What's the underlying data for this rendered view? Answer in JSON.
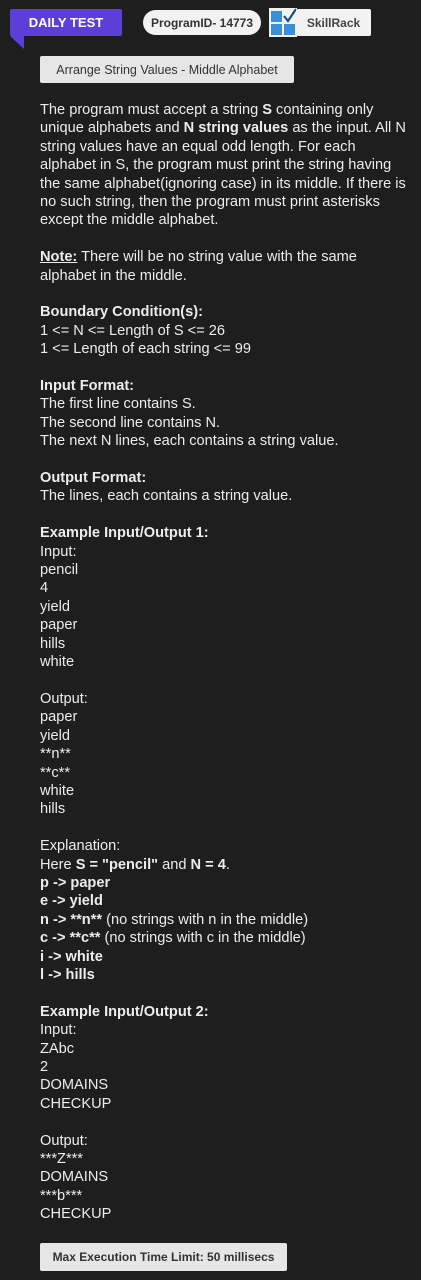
{
  "header": {
    "daily_test": "DAILY TEST",
    "program_id": "ProgramID- 14773",
    "skillrack": "SkillRack",
    "logo_icon": "skillrack-logo-icon"
  },
  "problem_title": "Arrange String Values - Middle Alphabet",
  "description": {
    "p1": "The program must accept a string ",
    "s_var": "S",
    "p2": " containing only unique alphabets and ",
    "n_var": "N string values",
    "p3": " as the input. All N string values have an equal odd length. For each alphabet in S, the program must print the string having the same alphabet(ignoring case) in its middle. If there is no such string, then the program must print asterisks except the middle alphabet."
  },
  "note": {
    "label": "Note:",
    "text": " There will be no string value with the same alphabet in the middle."
  },
  "boundary": {
    "heading": "Boundary Condition(s):",
    "lines": [
      "1 <= N <= Length of S <= 26",
      "1 <= Length of each string <= 99"
    ]
  },
  "input_format": {
    "heading": "Input Format:",
    "lines": [
      "The first line contains S.",
      "The second line contains N.",
      "The next N lines, each contains a string value."
    ]
  },
  "output_format": {
    "heading": "Output Format:",
    "lines": [
      "The lines, each contains a string value."
    ]
  },
  "example1": {
    "heading": "Example Input/Output 1:",
    "input_label": "Input:",
    "input": [
      "pencil",
      "4",
      "yield",
      "paper",
      "hills",
      "white"
    ],
    "output_label": "Output:",
    "output": [
      "paper",
      "yield",
      "**n**",
      "**c**",
      "white",
      "hills"
    ],
    "explanation_label": "Explanation:",
    "here_pre": "Here ",
    "here_bold": "S = \"pencil\"",
    "here_mid": " and ",
    "here_bold2": "N = 4",
    "here_end": ".",
    "mappings": [
      {
        "bold": "p -> paper",
        "rest": ""
      },
      {
        "bold": "e -> yield",
        "rest": ""
      },
      {
        "bold": "n -> **n**",
        "rest": " (no strings with n in the middle)"
      },
      {
        "bold": "c -> **c**",
        "rest": " (no strings with c in the middle)"
      },
      {
        "bold": "i -> white",
        "rest": ""
      },
      {
        "bold": "l -> hills",
        "rest": ""
      }
    ]
  },
  "example2": {
    "heading": "Example Input/Output 2:",
    "input_label": "Input:",
    "input": [
      "ZAbc",
      "2",
      "DOMAINS",
      "CHECKUP"
    ],
    "output_label": "Output:",
    "output": [
      "***Z***",
      "DOMAINS",
      "***b***",
      "CHECKUP"
    ]
  },
  "time_limit": "Max Execution Time Limit: 50 millisecs",
  "colors": {
    "background": "#1e1e1e",
    "accent": "#5b3fd6",
    "chip": "#e6e6e6",
    "text": "#ececec",
    "logo_blue": "#3a8fd9"
  }
}
